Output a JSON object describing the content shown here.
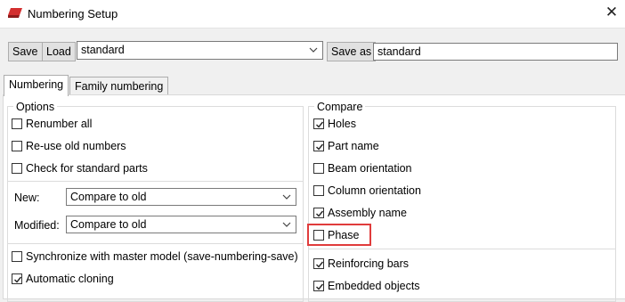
{
  "window": {
    "title": "Numbering Setup",
    "close_glyph": "✕"
  },
  "toolbar": {
    "save_label": "Save",
    "load_label": "Load",
    "setting_value": "standard",
    "save_as_label": "Save as",
    "save_as_value": "standard"
  },
  "tabs": [
    {
      "label": "Numbering",
      "active": true
    },
    {
      "label": "Family numbering",
      "active": false
    }
  ],
  "options": {
    "title": "Options",
    "checkboxes": [
      {
        "label": "Renumber all",
        "checked": false
      },
      {
        "label": "Re-use old numbers",
        "checked": false
      },
      {
        "label": "Check for standard parts",
        "checked": false
      }
    ],
    "new_label": "New:",
    "new_value": "Compare to old",
    "modified_label": "Modified:",
    "modified_value": "Compare to old",
    "bottom_checkboxes": [
      {
        "label": "Synchronize with master model (save-numbering-save)",
        "checked": false
      },
      {
        "label": "Automatic cloning",
        "checked": true
      }
    ]
  },
  "compare": {
    "title": "Compare",
    "checkboxes": [
      {
        "label": "Holes",
        "checked": true
      },
      {
        "label": "Part name",
        "checked": true
      },
      {
        "label": "Beam orientation",
        "checked": false
      },
      {
        "label": "Column orientation",
        "checked": false
      },
      {
        "label": "Assembly name",
        "checked": true
      },
      {
        "label": "Phase",
        "checked": false
      }
    ],
    "bottom_checkboxes": [
      {
        "label": "Reinforcing bars",
        "checked": true
      },
      {
        "label": "Embedded objects",
        "checked": true
      }
    ]
  },
  "colors": {
    "highlight": "#e03c3c",
    "app_icon": "#d32f2f"
  },
  "icons": {
    "app": "app-logo-icon",
    "close": "close-icon",
    "dropdown": "chevron-down-icon",
    "check": "checkmark-icon"
  }
}
